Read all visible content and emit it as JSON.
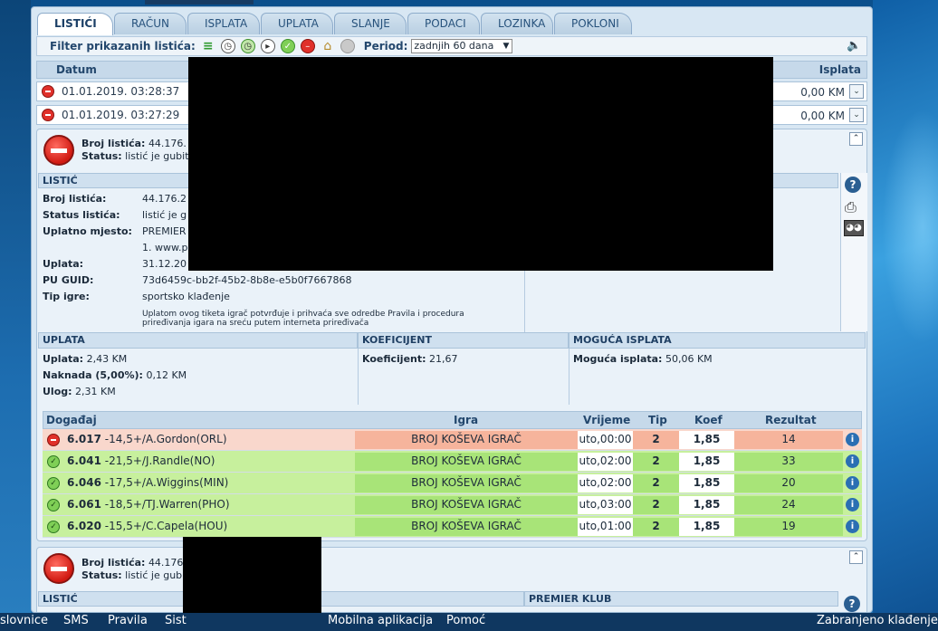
{
  "tabs": [
    "LISTIĆI",
    "RAČUN",
    "ISPLATA",
    "UPLATA",
    "SLANJE",
    "PODACI",
    "LOZINKA",
    "POKLONI"
  ],
  "filter": {
    "label": "Filter prikazanih listića:",
    "period_label": "Period:",
    "period_value": "zadnjih 60 dana",
    "icons": [
      "list-icon",
      "clock-icon",
      "clock-green-icon",
      "play-icon",
      "check-icon",
      "stop-icon",
      "home-icon",
      "gray-circle-icon"
    ]
  },
  "list_header": {
    "datum": "Datum",
    "isplata": "Isplata"
  },
  "rows": [
    {
      "datum": "01.01.2019. 03:28:37",
      "isplata": "0,00 KM"
    },
    {
      "datum": "01.01.2019. 03:27:29",
      "isplata": "0,00 KM"
    }
  ],
  "ticket": {
    "broj_label": "Broj listića:",
    "broj_value": "44.176.",
    "status_label": "Status:",
    "status_value": "listić je gubit",
    "section_listic": "LISTIĆ",
    "fields": {
      "broj_label": "Broj listića:",
      "broj_value": "44.176.2",
      "status_label": "Status listića:",
      "status_value": "listić je g",
      "mjesto_label": "Uplatno mjesto:",
      "mjesto_value": "PREMIER",
      "mjesto_value2": "1. www.p",
      "uplata_label": "Uplata:",
      "uplata_value": "31.12.20",
      "guid_label": "PU GUID:",
      "guid_value": "73d6459c-bb2f-45b2-8b8e-e5b0f7667868",
      "tip_label": "Tip igre:",
      "tip_value": "sportsko klađenje",
      "note": "Uplatom ovog tiketa igrač potvrđuje i prihvaća sve odredbe Pravila i procedura priređivanja igara na sreću putem interneta priređivača"
    },
    "uplata_title": "UPLATA",
    "uplata_lines": {
      "uplata_label": "Uplata:",
      "uplata_value": "2,43 KM",
      "naknada_label": "Naknada (5,00%):",
      "naknada_value": "0,12 KM",
      "ulog_label": "Ulog:",
      "ulog_value": "2,31 KM"
    },
    "koef_title": "KOEFICIJENT",
    "koef_label": "Koeficijent:",
    "koef_value": "21,67",
    "isplata_title": "MOGUĆA ISPLATA",
    "isplata_label": "Moguća isplata:",
    "isplata_value": "50,06 KM"
  },
  "events_header": {
    "dogadaj": "Događaj",
    "igra": "Igra",
    "vrijeme": "Vrijeme",
    "tip": "Tip",
    "koef": "Koef",
    "rezultat": "Rezultat"
  },
  "events": [
    {
      "status": "lost",
      "code": "6.017",
      "desc": "-14,5+/A.Gordon(ORL)",
      "igra": "BROJ KOŠEVA IGRAČ",
      "vrijeme": "uto,00:00",
      "tip": "2",
      "koef": "1,85",
      "rezultat": "14"
    },
    {
      "status": "won",
      "code": "6.041",
      "desc": "-21,5+/J.Randle(NO)",
      "igra": "BROJ KOŠEVA IGRAČ",
      "vrijeme": "uto,02:00",
      "tip": "2",
      "koef": "1,85",
      "rezultat": "33"
    },
    {
      "status": "won",
      "code": "6.046",
      "desc": "-17,5+/A.Wiggins(MIN)",
      "igra": "BROJ KOŠEVA IGRAČ",
      "vrijeme": "uto,02:00",
      "tip": "2",
      "koef": "1,85",
      "rezultat": "20"
    },
    {
      "status": "won",
      "code": "6.061",
      "desc": "-18,5+/TJ.Warren(PHO)",
      "igra": "BROJ KOŠEVA IGRAČ",
      "vrijeme": "uto,03:00",
      "tip": "2",
      "koef": "1,85",
      "rezultat": "24"
    },
    {
      "status": "won",
      "code": "6.020",
      "desc": "-15,5+/C.Capela(HOU)",
      "igra": "BROJ KOŠEVA IGRAČ",
      "vrijeme": "uto,01:00",
      "tip": "2",
      "koef": "1,85",
      "rezultat": "19"
    }
  ],
  "ticket2": {
    "broj_label": "Broj listića:",
    "broj_value": "44.176",
    "status_label": "Status:",
    "status_value": "listić je gub",
    "section_listic": "LISTIĆ",
    "section_right": "PREMIER KLUB"
  },
  "footer": {
    "items": [
      "slovnice",
      "SMS",
      "Pravila",
      "Sist",
      "Mobilna aplikacija",
      "Pomoć"
    ],
    "right": "Zabranjeno klađenje"
  }
}
